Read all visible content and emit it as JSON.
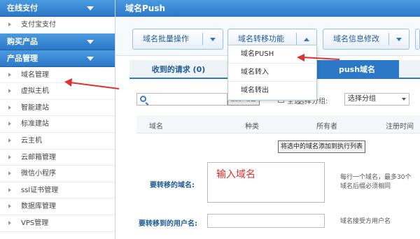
{
  "sidebar": {
    "sections": [
      {
        "title": "在线支付"
      },
      {
        "title": "购买产品"
      },
      {
        "title": "产品管理"
      }
    ],
    "pay_items": [
      "支付宝支付"
    ],
    "product_items": [
      "域名管理",
      "虚拟主机",
      "智能建站",
      "标准建站",
      "云主机",
      "云邮箱管理",
      "微信小程序",
      "ssl证书管理",
      "数据库管理",
      "VPS管理"
    ]
  },
  "header": {
    "title": "域名Push"
  },
  "toolbar": {
    "batch_label": "域名批量操作",
    "transfer_label": "域名转移功能",
    "info_label": "域名信息修改"
  },
  "dropdown": {
    "items": [
      "域名PUSH",
      "域名转入",
      "域名转出"
    ]
  },
  "tabs": {
    "received": "收到的请求 (0)",
    "push": "push域名"
  },
  "search": {
    "button": "搜索域名",
    "checkbox_label": "全选",
    "group_label": "选择分组:",
    "group_selected": "选择分组"
  },
  "table": {
    "columns": [
      "域名",
      "种类",
      "所有者",
      "注册时间"
    ],
    "add_button": "将选中的域名添加到执行列表"
  },
  "form": {
    "domain_label": "要转移的域名:",
    "domain_value": "输入域名",
    "domain_hint_1": "每行一个域名，最多30个",
    "domain_hint_2": "域名后缀必须相同",
    "user_label": "要转移到的用户名:",
    "user_hint": "域名接受方用户名"
  },
  "colors": {
    "accent": "#2c78c8",
    "annotation": "#e03030"
  }
}
